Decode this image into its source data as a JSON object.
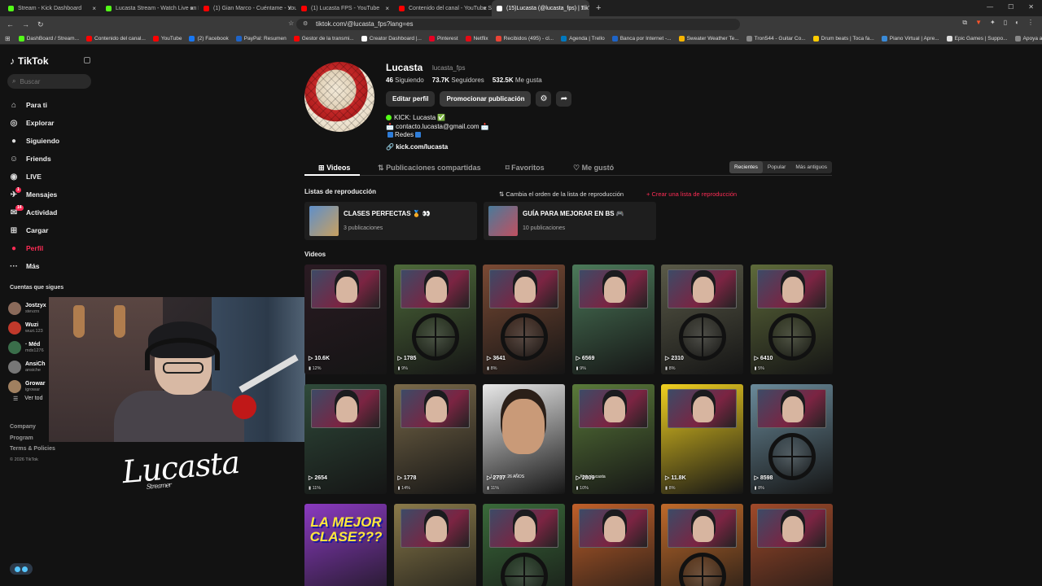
{
  "browser": {
    "tabs": [
      {
        "title": "Stream - Kick Dashboard",
        "color": "#53fc18"
      },
      {
        "title": "Lucasta Stream - Watch Live on Kick",
        "color": "#53fc18"
      },
      {
        "title": "(1) Gian Marco - Cuéntame - YouTube",
        "color": "#ff0000"
      },
      {
        "title": "(1) Lucasta FPS - YouTube",
        "color": "#ff0000"
      },
      {
        "title": "Contenido del canal - YouTube Studio",
        "color": "#ff0000"
      },
      {
        "title": "(15)Lucasta (@lucasta_fps) | TikTok",
        "color": "#ffffff"
      }
    ],
    "new_tab": "+",
    "url": "tiktok.com/@lucasta_fps?lang=es",
    "bookmarks": [
      {
        "label": "DashBoard / Stream...",
        "color": "#53fc18"
      },
      {
        "label": "Contenido del canal...",
        "color": "#ff0000"
      },
      {
        "label": "YouTube",
        "color": "#ff0000"
      },
      {
        "label": "(2) Facebook",
        "color": "#1877f2"
      },
      {
        "label": "PayPal: Resumen",
        "color": "#1e64c8"
      },
      {
        "label": "Gestor de la transmi...",
        "color": "#ff0000"
      },
      {
        "label": "Creator Dashboard |...",
        "color": "#ffffff"
      },
      {
        "label": "Pinterest",
        "color": "#e60023"
      },
      {
        "label": "Netflix",
        "color": "#e50914"
      },
      {
        "label": "Recibidos (495) - cl...",
        "color": "#ea4335"
      },
      {
        "label": "Agenda | Trello",
        "color": "#0079bf"
      },
      {
        "label": "Banca por Internet -...",
        "color": "#1e64c8"
      },
      {
        "label": "Sweater Weather Te...",
        "color": "#f5b400"
      },
      {
        "label": "Tron544 - Guitar Co...",
        "color": "#888888"
      },
      {
        "label": "Drum beats | Toca fa...",
        "color": "#ffcc00"
      },
      {
        "label": "Piano Virtual | Apre...",
        "color": "#3a8bd8"
      },
      {
        "label": "Epic Games | Suppo...",
        "color": "#dddddd"
      },
      {
        "label": "Apoya a un creador...",
        "color": "#888888"
      }
    ]
  },
  "sidebar": {
    "brand": "TikTok",
    "search_placeholder": "Buscar",
    "nav": [
      {
        "label": "Para ti",
        "icon": "home-icon",
        "glyph": "⌂",
        "badge": ""
      },
      {
        "label": "Explorar",
        "icon": "compass-icon",
        "glyph": "◎",
        "badge": ""
      },
      {
        "label": "Siguiendo",
        "icon": "following-avatar-icon",
        "glyph": "●",
        "badge": ""
      },
      {
        "label": "Friends",
        "icon": "friends-icon",
        "glyph": "☺",
        "badge": ""
      },
      {
        "label": "LIVE",
        "icon": "live-icon",
        "glyph": "◉",
        "badge": ""
      },
      {
        "label": "Mensajes",
        "icon": "messages-icon",
        "glyph": "✈",
        "badge": "1"
      },
      {
        "label": "Actividad",
        "icon": "activity-icon",
        "glyph": "✉",
        "badge": "14"
      },
      {
        "label": "Cargar",
        "icon": "upload-icon",
        "glyph": "⊞",
        "badge": ""
      },
      {
        "label": "Perfil",
        "icon": "profile-icon",
        "glyph": "●",
        "badge": ""
      },
      {
        "label": "Más",
        "icon": "more-icon",
        "glyph": "···",
        "badge": ""
      }
    ],
    "following_title": "Cuentas que sigues",
    "following": [
      {
        "name": "Jostzyx",
        "sub": "stevzrx",
        "color": "#8a6a5a"
      },
      {
        "name": "Wuzi",
        "sub": "wuzi.123",
        "color": "#c0392b"
      },
      {
        "name": "· Méd",
        "sub": "mdx1276",
        "color": "#3a6e4a"
      },
      {
        "name": "AnsiCh",
        "sub": "ansiche",
        "color": "#777777"
      },
      {
        "name": "Growar",
        "sub": "igrowar",
        "color": "#a08060"
      }
    ],
    "see_all": "Ver tod",
    "footer": [
      "Company",
      "Program",
      "Terms & Policies"
    ],
    "copyright": "© 2026 TikTok"
  },
  "overlay": {
    "signature": "Lucasta",
    "signature_sub": "Streamer"
  },
  "profile": {
    "name": "Lucasta",
    "handle": "lucasta_fps",
    "following_count": "46",
    "following_label": "Siguiendo",
    "followers_count": "73.7K",
    "followers_label": "Seguidores",
    "likes_count": "532.5K",
    "likes_label": "Me gusta",
    "edit_button": "Editar perfil",
    "promote_button": "Promocionar publicación",
    "bio_line1": "KICK: Lucasta ✅",
    "bio_line2": "📩 contacto.lucasta@gmail.com 📩",
    "bio_line3": "Redes",
    "link": "kick.com/lucasta"
  },
  "tabs": {
    "videos": "Videos",
    "shared": "Publicaciones compartidas",
    "favorites": "Favoritos",
    "liked": "Me gustó",
    "sort": [
      "Recientes",
      "Popular",
      "Más antiguos"
    ]
  },
  "playlists": {
    "title": "Listas de reproducción",
    "reorder": "Cambia el orden de la lista de reproducción",
    "create": "+ Crear una lista de reproducción",
    "items": [
      {
        "name": "CLASES PERFECTAS 🏅 👀",
        "count": "3 publicaciones",
        "color": "#5f8fc9"
      },
      {
        "name": "GUÍA PARA MEJORAR EN BS 🎮",
        "count": "10 publicaciones",
        "color": "#4a7a9a"
      }
    ]
  },
  "videos": {
    "title": "Videos",
    "items": [
      {
        "views": "10.6K",
        "pct": "12%",
        "bg": "#2a1a22",
        "kind": "cam"
      },
      {
        "views": "1785",
        "pct": "9%",
        "bg": "#4e6a3a",
        "kind": "scope"
      },
      {
        "views": "3641",
        "pct": "8%",
        "bg": "#7a4a34",
        "kind": "scope"
      },
      {
        "views": "6569",
        "pct": "9%",
        "bg": "#4c7a5a",
        "kind": "cam"
      },
      {
        "views": "2310",
        "pct": "8%",
        "bg": "#5a5a48",
        "kind": "scope"
      },
      {
        "views": "6410",
        "pct": "5%",
        "bg": "#5e6a3a",
        "kind": "scope"
      },
      {
        "views": "2654",
        "pct": "11%",
        "bg": "#2f4a3a",
        "kind": "cam"
      },
      {
        "views": "1778",
        "pct": "14%",
        "bg": "#7a6a4a",
        "kind": "cam"
      },
      {
        "views": "2737",
        "pct": "11%",
        "bg": "#e8e8e8",
        "kind": "face",
        "caption": "Lucasta: 26 AÑOS"
      },
      {
        "views": "2809",
        "pct": "10%",
        "bg": "#5a7a3a",
        "kind": "cam",
        "caption": "Kick : Lucasta"
      },
      {
        "views": "11.8K",
        "pct": "8%",
        "bg": "#f0d020",
        "kind": "cam"
      },
      {
        "views": "8598",
        "pct": "8%",
        "bg": "#6a8a9a",
        "kind": "scope"
      },
      {
        "views": "",
        "pct": "",
        "bg": "#8a3ac0",
        "kind": "text",
        "text": "LA MEJOR CLASE???"
      },
      {
        "views": "",
        "pct": "",
        "bg": "#8a7a4a",
        "kind": "cam"
      },
      {
        "views": "",
        "pct": "",
        "bg": "#3a6a3a",
        "kind": "scope"
      },
      {
        "views": "",
        "pct": "",
        "bg": "#c0602a",
        "kind": "cam"
      },
      {
        "views": "",
        "pct": "",
        "bg": "#c06a2a",
        "kind": "scope"
      },
      {
        "views": "",
        "pct": "",
        "bg": "#a04a2a",
        "kind": "cam"
      }
    ]
  }
}
